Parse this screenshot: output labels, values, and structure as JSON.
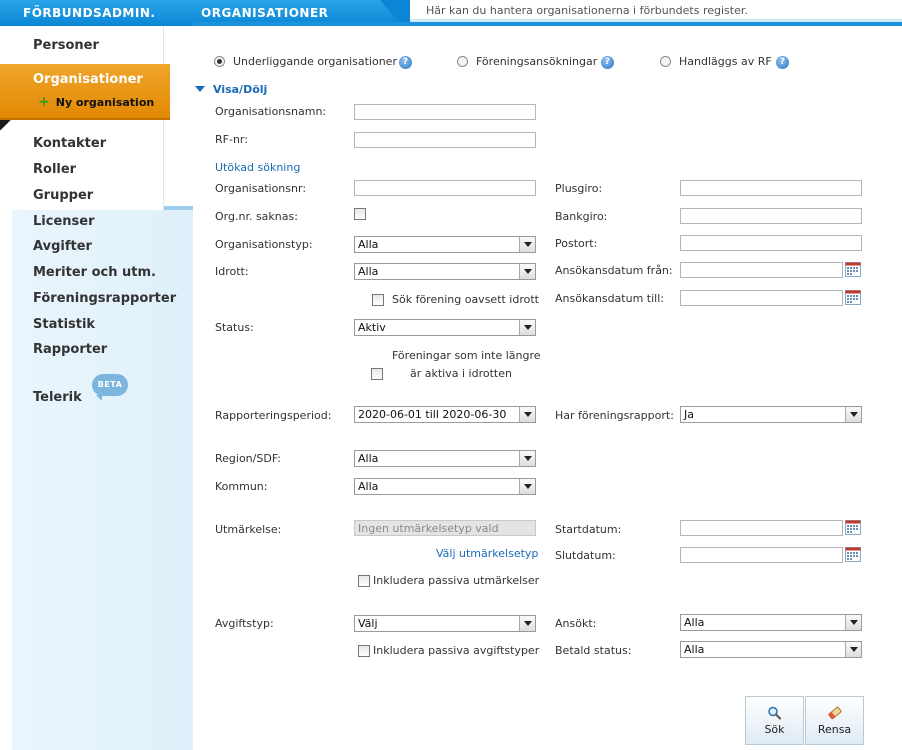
{
  "header": {
    "brand": "FÖRBUNDSADMIN.",
    "section": "ORGANISATIONER",
    "helptext": "Här kan du hantera organisationerna i förbundets register."
  },
  "sidebar": {
    "items_top": [
      "Personer"
    ],
    "active": "Organisationer",
    "new_org": "Ny organisation",
    "items": [
      "Kontakter",
      "Roller",
      "Grupper",
      "Licenser",
      "Avgifter",
      "Meriter och utm.",
      "Föreningsrapporter",
      "Statistik",
      "Rapporter"
    ],
    "telerik": "Telerik",
    "beta": "BETA"
  },
  "tabs": {
    "underliggande": "Underliggande organisationer",
    "foreningsansokningar": "Föreningsansökningar",
    "handlaggs": "Handläggs av RF"
  },
  "toggle": "Visa/Dölj",
  "fields": {
    "organisationsnamn": "Organisationsnamn:",
    "rfnr": "RF-nr:",
    "utokad": "Utökad sökning",
    "organisationsnr": "Organisationsnr:",
    "orgnr_saknas": "Org.nr. saknas:",
    "organisationstyp": "Organisationstyp:",
    "organisationstyp_value": "Alla",
    "idrott": "Idrott:",
    "idrott_value": "Alla",
    "sok_forening": "Sök förening oavsett idrott",
    "status": "Status:",
    "status_value": "Aktiv",
    "inactive_line1": "Föreningar som inte längre",
    "inactive_line2": "är aktiva i idrotten",
    "rapporteringsperiod": "Rapporteringsperiod:",
    "rapporteringsperiod_value": "2020-06-01 till 2020-06-30",
    "region": "Region/SDF:",
    "region_value": "Alla",
    "kommun": "Kommun:",
    "kommun_value": "Alla",
    "utmarkelse": "Utmärkelse:",
    "utmarkelse_value": "Ingen utmärkelsetyp vald",
    "valj_utmarkelse": "Välj utmärkelsetyp",
    "inkl_passiva_utm": "Inkludera passiva utmärkelser",
    "avgiftstyp": "Avgiftstyp:",
    "avgiftstyp_value": "Välj",
    "inkl_passiva_avg": "Inkludera passiva avgiftstyper",
    "plusgiro": "Plusgiro:",
    "bankgiro": "Bankgiro:",
    "postort": "Postort:",
    "ansokan_fran": "Ansökansdatum från:",
    "ansokan_till": "Ansökansdatum till:",
    "har_rapport": "Har föreningsrapport:",
    "har_rapport_value": "Ja",
    "startdatum": "Startdatum:",
    "slutdatum": "Slutdatum:",
    "ansokt": "Ansökt:",
    "ansokt_value": "Alla",
    "betald": "Betald status:",
    "betald_value": "Alla"
  },
  "buttons": {
    "sok": "Sök",
    "rensa": "Rensa"
  }
}
